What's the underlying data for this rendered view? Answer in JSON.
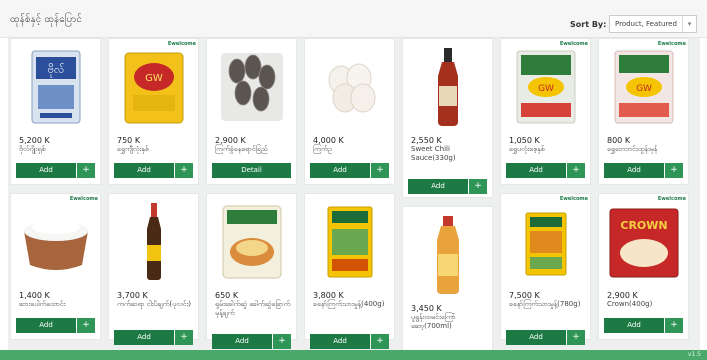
{
  "header": {
    "title": "ထုန်စ်နှင့် ထုန်ပြောင်",
    "sort_label": "Sort By:",
    "sort_value": "Product, Featured"
  },
  "buttons": {
    "add": "Add",
    "plus": "+",
    "detail": "Detail"
  },
  "products_row1": [
    {
      "price": "5,200 K",
      "name": "ဗိုလ်ဂျိုးရှစ်",
      "button": "Add",
      "badge": ""
    },
    {
      "price": "750 K",
      "name": "ရွှေကျီလုံးနှစ်",
      "button": "Add",
      "badge": "Ewelcome"
    },
    {
      "price": "2,900 K",
      "name": "ကြက်ခွံနေရောင်ခြည်",
      "button": "Detail",
      "badge": ""
    },
    {
      "price": "4,000 K",
      "name": "ကြက်ဥ",
      "button": "Add",
      "badge": ""
    },
    {
      "price": "2,550 K",
      "name": "Sweet Chili Sauce(330g)",
      "button": "Add",
      "badge": ""
    },
    {
      "price": "1,050 K",
      "name": "ရွှေပလုံးစေ့နှစ်",
      "button": "Add",
      "badge": "Ewelcome"
    },
    {
      "price": "800 K",
      "name": "ရွှေဘေဘင်းထွန်းမှန်",
      "button": "Add",
      "badge": "Ewelcome"
    }
  ],
  "products_row2": [
    {
      "price": "1,400 K",
      "name": "ဆားပေါက်ထောင်း",
      "button": "Add",
      "badge": "Ewelcome"
    },
    {
      "price": "3,700 K",
      "name": "ကက်ဆရာ ငါးပိချက်(ပုလင်း)",
      "button": "Add",
      "badge": ""
    },
    {
      "price": "650 K",
      "name": "ရှမ်းခေါက်ဆွဲ ခေါက်ဆွဲခြောက် မုန့်ချက်",
      "button": "Add",
      "badge": ""
    },
    {
      "price": "3,800 K",
      "name": "ခနော်ကြက်သားမှုန့်(400g)",
      "button": "Add",
      "badge": ""
    },
    {
      "price": "3,450 K",
      "name": "ပူရွန်းထမင်းကြော်ဆော့(700ml)",
      "button": "Add",
      "badge": ""
    },
    {
      "price": "7,500 K",
      "name": "ခနော်ကြက်သားမှုန့်(780g)",
      "button": "Add",
      "badge": "Ewelcome"
    },
    {
      "price": "2,900 K",
      "name": "Crown(400g)",
      "button": "Add",
      "badge": "Ewelcome"
    }
  ],
  "footer": {
    "version": "v1.5"
  },
  "colors": {
    "accent": "#1d7a45",
    "accent_light": "#2e9556",
    "footer": "#49a86a"
  }
}
